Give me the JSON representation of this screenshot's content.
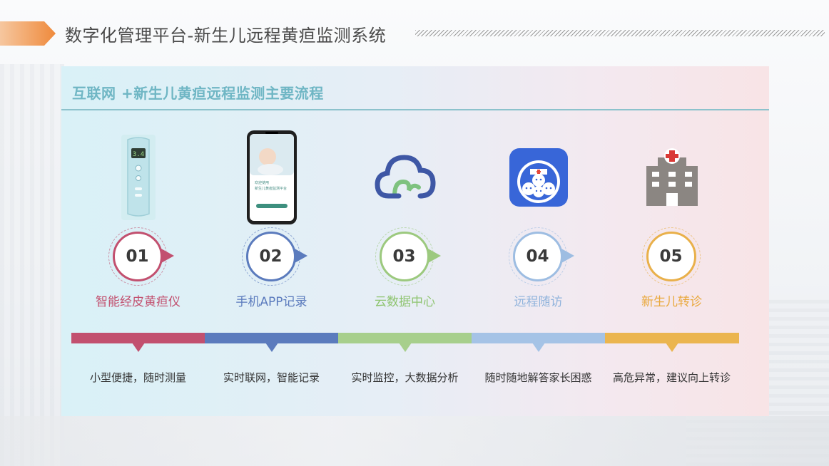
{
  "header": {
    "title": "数字化管理平台-新生儿远程黄疸监测系统"
  },
  "panel": {
    "title": "互联网 +新生儿黄疸远程监测主要流程"
  },
  "colors": {
    "step1": "#c2506f",
    "step2": "#5b7bbd",
    "step3": "#9cc97e",
    "step4": "#9dbde2",
    "step5": "#e9b04a",
    "accent_orange": "#ef8a3c",
    "panel_title": "#6fb6c4"
  },
  "steps": [
    {
      "number": "01",
      "label": "智能经皮黄疸仪",
      "desc": "小型便捷，随时测量",
      "icon": "jaundice-meter-device-icon"
    },
    {
      "number": "02",
      "label": "手机APP记录",
      "desc": "实时联网，智能记录",
      "icon": "smartphone-app-icon"
    },
    {
      "number": "03",
      "label": "云数据中心",
      "desc": "实时监控，大数据分析",
      "icon": "cloud-data-center-icon"
    },
    {
      "number": "04",
      "label": "远程随访",
      "desc": "随时随地解答家长困惑",
      "icon": "remote-followup-family-icon"
    },
    {
      "number": "05",
      "label": "新生儿转诊",
      "desc": "高危异常，建议向上转诊",
      "icon": "hospital-building-icon"
    }
  ],
  "phone_screen": {
    "title_line1": "欢迎使用",
    "title_line2": "新生儿黄疸监测平台"
  },
  "device_screen": {
    "reading": "3.4"
  }
}
